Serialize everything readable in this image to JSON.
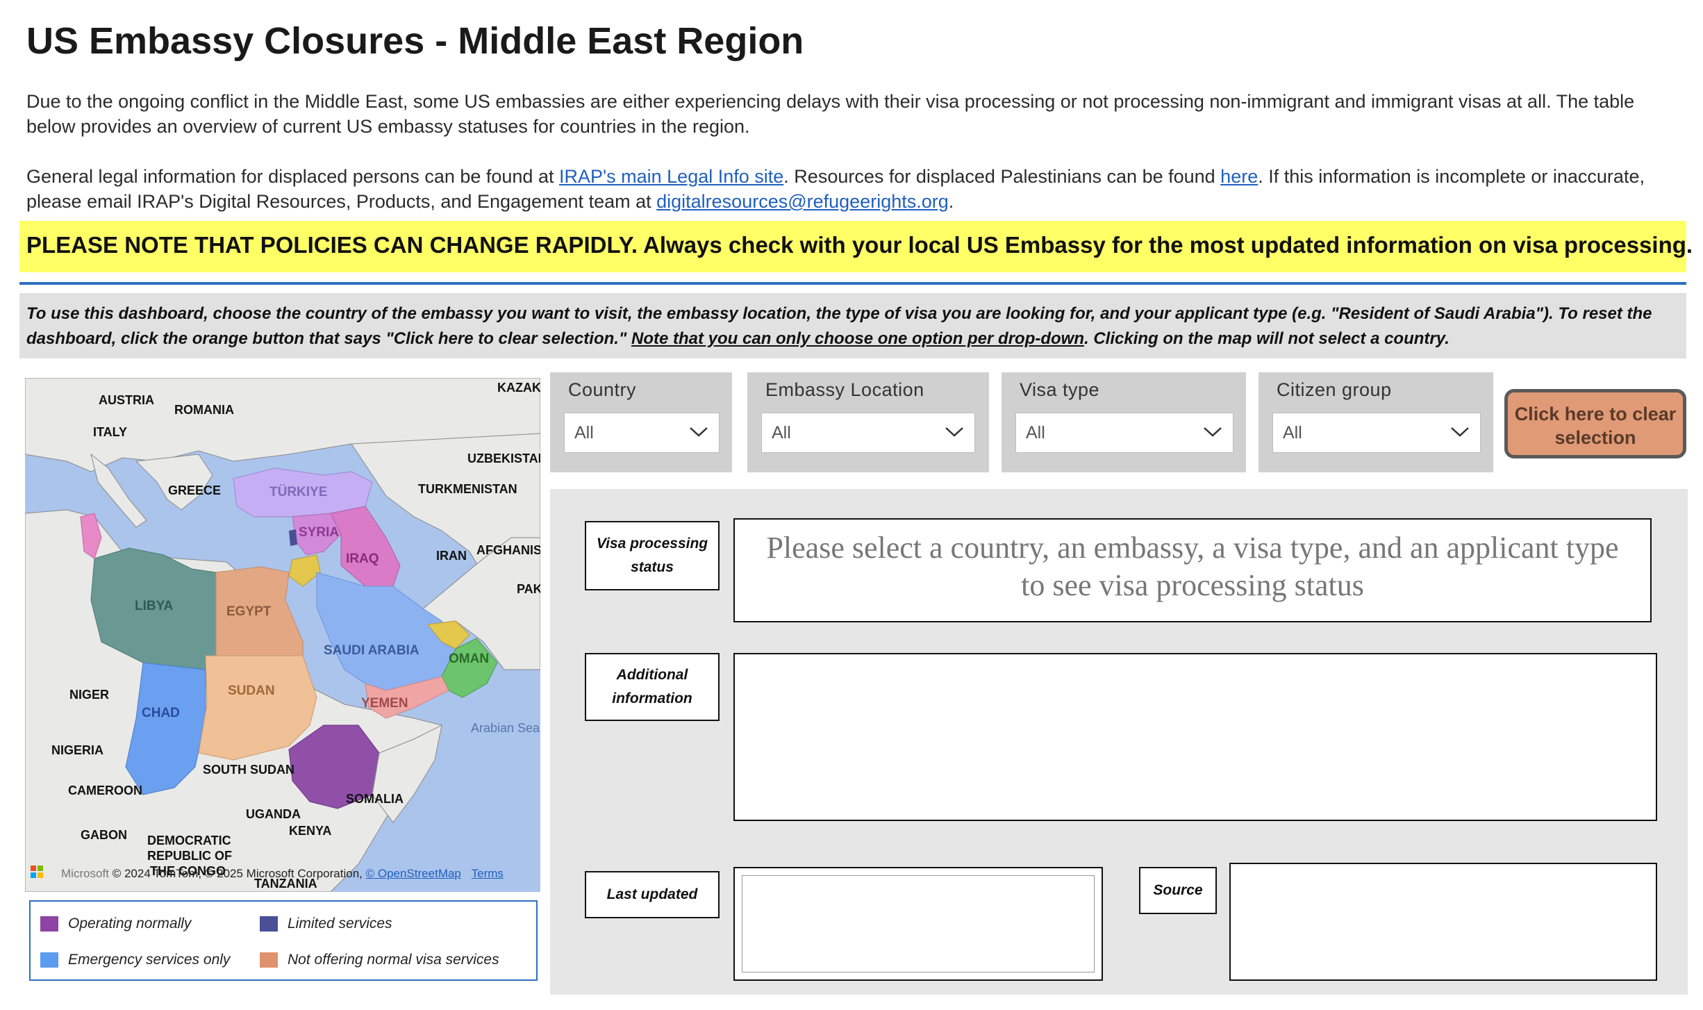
{
  "header": {
    "title": "US Embassy Closures - Middle East Region",
    "intro": "Due to the ongoing conflict in the Middle East, some US embassies are either experiencing delays with their visa processing or not processing non-immigrant and immigrant visas at all. The table below provides an overview of current US embassy statuses for countries in the region.",
    "legal_part1": "General legal information for displaced persons can be found at ",
    "legal_link1": "IRAP's main Legal Info site",
    "legal_part2": ". Resources for displaced Palestinians can be found ",
    "legal_link2": "here",
    "legal_part3": ". If this information is incomplete or inaccurate, please email IRAP's Digital Resources, Products, and Engagement team at ",
    "legal_email": "digitalresources@refugeerights.org",
    "legal_part4": "."
  },
  "notice": "PLEASE NOTE THAT POLICIES CAN CHANGE RAPIDLY. Always check with your local US Embassy for the most updated information on visa processing.",
  "instructions": {
    "part1": "To use this dashboard, choose the country of the embassy you want to visit, the embassy location, the type of visa you are looking for, and your applicant type (e.g. \"Resident of Saudi Arabia\"). To reset the dashboard, click the orange button that says \"Click here to clear selection.\" ",
    "underlined": "Note that you can only choose one option per drop-down",
    "part2": ". Clicking on the map will not select a country."
  },
  "map": {
    "labels": {
      "kazak": "KAZAK",
      "austria": "AUSTRIA",
      "romania": "ROMANIA",
      "italy": "ITALY",
      "uzbekistan": "UZBEKISTAN",
      "greece": "GREECE",
      "turkiye": "TÜRKIYE",
      "turkmenistan": "TURKMENISTAN",
      "syria": "SYRIA",
      "iraq": "IRAQ",
      "iran": "IRAN",
      "afghanistan": "AFGHANIS",
      "libya": "LIBYA",
      "egypt": "EGYPT",
      "pak": "PAK",
      "saudi": "SAUDI ARABIA",
      "oman": "OMAN",
      "niger": "NIGER",
      "sudan": "SUDAN",
      "chad": "CHAD",
      "yemen": "YEMEN",
      "arabian_sea": "Arabian Sea",
      "nigeria": "NIGERIA",
      "south_sudan": "SOUTH SUDAN",
      "cameroon": "CAMEROON",
      "somalia": "SOMALIA",
      "uganda": "UGANDA",
      "kenya": "KENYA",
      "gabon": "GABON",
      "drc1": "DEMOCRATIC",
      "drc2": "REPUBLIC OF",
      "drc3": "THE CONGO",
      "tanzania": "TANZANIA"
    },
    "ms_brand": "Microsoft",
    "attribution": "© 2024 TomTom, © 2025 Microsoft Corporation,",
    "osm": "© OpenStreetMap",
    "terms": "Terms"
  },
  "legend": {
    "items": [
      {
        "label": "Operating normally",
        "color": "#8e44a5"
      },
      {
        "label": "Limited services",
        "color": "#4a4f96"
      },
      {
        "label": "Emergency services only",
        "color": "#5b9bf0"
      },
      {
        "label": "Not offering normal visa services",
        "color": "#e0916e"
      }
    ]
  },
  "slicers": {
    "country": {
      "title": "Country",
      "value": "All"
    },
    "embassy": {
      "title": "Embassy Location",
      "value": "All"
    },
    "visa": {
      "title": "Visa type",
      "value": "All"
    },
    "citizen": {
      "title": "Citizen group",
      "value": "All"
    }
  },
  "clear_button": {
    "line1": "Click here to clear",
    "line2": "selection"
  },
  "panel": {
    "status_label": {
      "line1": "Visa processing",
      "line2": "status"
    },
    "status_message": {
      "line1": "Please select a country, an embassy, a visa type, and an applicant type",
      "line2": "to see visa processing status"
    },
    "additional_label": {
      "line1": "Additional",
      "line2": "information"
    },
    "last_updated_label": "Last updated",
    "source_label": "Source"
  },
  "colors": {
    "accent_blue": "#2f6fc4",
    "notice_yellow": "#ffff66",
    "clear_button": "#e19a76"
  }
}
